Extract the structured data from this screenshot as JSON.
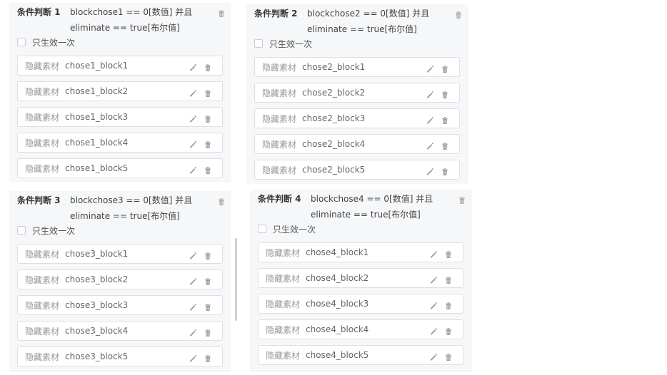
{
  "panels": [
    {
      "title": "条件判断 1",
      "cond1": "blockchose1 == 0[数值] 并且",
      "cond2": "eliminate == true[布尔值]",
      "once_label": "只生效一次",
      "blocks": [
        {
          "type": "隐藏素材",
          "name": "chose1_block1"
        },
        {
          "type": "隐藏素材",
          "name": "chose1_block2"
        },
        {
          "type": "隐藏素材",
          "name": "chose1_block3"
        },
        {
          "type": "隐藏素材",
          "name": "chose1_block4"
        },
        {
          "type": "隐藏素材",
          "name": "chose1_block5"
        }
      ]
    },
    {
      "title": "条件判断 2",
      "cond1": "blockchose2 == 0[数值] 并且",
      "cond2": "eliminate == true[布尔值]",
      "once_label": "只生效一次",
      "blocks": [
        {
          "type": "隐藏素材",
          "name": "chose2_block1"
        },
        {
          "type": "隐藏素材",
          "name": "chose2_block2"
        },
        {
          "type": "隐藏素材",
          "name": "chose2_block3"
        },
        {
          "type": "隐藏素材",
          "name": "chose2_block4"
        },
        {
          "type": "隐藏素材",
          "name": "chose2_block5"
        }
      ]
    },
    {
      "title": "条件判断 3",
      "cond1": "blockchose3 == 0[数值] 并且",
      "cond2": "eliminate == true[布尔值]",
      "once_label": "只生效一次",
      "blocks": [
        {
          "type": "隐藏素材",
          "name": "chose3_block1"
        },
        {
          "type": "隐藏素材",
          "name": "chose3_block2"
        },
        {
          "type": "隐藏素材",
          "name": "chose3_block3"
        },
        {
          "type": "隐藏素材",
          "name": "chose3_block4"
        },
        {
          "type": "隐藏素材",
          "name": "chose3_block5"
        }
      ]
    },
    {
      "title": "条件判断 4",
      "cond1": "blockchose4 == 0[数值] 并且",
      "cond2": "eliminate == true[布尔值]",
      "once_label": "只生效一次",
      "blocks": [
        {
          "type": "隐藏素材",
          "name": "chose4_block1"
        },
        {
          "type": "隐藏素材",
          "name": "chose4_block2"
        },
        {
          "type": "隐藏素材",
          "name": "chose4_block3"
        },
        {
          "type": "隐藏素材",
          "name": "chose4_block4"
        },
        {
          "type": "隐藏素材",
          "name": "chose4_block5"
        }
      ]
    }
  ],
  "icons": {
    "edit": "pencil-icon",
    "delete": "trash-icon"
  },
  "colors": {
    "panel_bg": "#f6f7f9",
    "row_border": "#dcdfe6",
    "icon": "#9a9a9a"
  }
}
